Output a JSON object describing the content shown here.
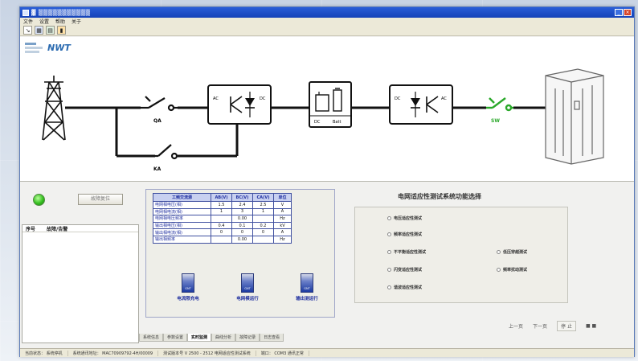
{
  "window": {
    "title": "▓ ▒▒▒▒▒▒▒▒▒▒▒"
  },
  "menu": [
    "文件",
    "设置",
    "帮助",
    "关于"
  ],
  "toolbar_icons": [
    "connect-icon",
    "grid-icon",
    "chart-icon",
    "folder-icon"
  ],
  "brand": {
    "logo_text": "NWT"
  },
  "diagram": {
    "labels": {
      "qa": "QA",
      "ka": "KA",
      "ac1": "AC",
      "dc1": "DC",
      "dc_box": "DC",
      "batt": "Batt",
      "dc2": "DC",
      "ac2": "AC",
      "sw": "SW"
    },
    "colors": {
      "breaker_active": "#29a829",
      "line": "#111111"
    }
  },
  "left_panel": {
    "reset_label": "故障复位",
    "log_headers": [
      "序号",
      "故障/告警"
    ]
  },
  "params": {
    "headers": [
      "工频交流源",
      "AB(V)",
      "BC(V)",
      "CA(V)",
      "单位"
    ],
    "rows": [
      {
        "name": "电网相电压(相)",
        "a": "1.5",
        "b": "2.4",
        "c": "2.5",
        "u": "V"
      },
      {
        "name": "电网相电流(相)",
        "a": "1",
        "b": "3",
        "c": "1",
        "u": "A"
      },
      {
        "name": "电网相电压频率",
        "a": "",
        "b": "0.00",
        "c": "",
        "u": "Hz"
      },
      {
        "name": "输出相电压(相)",
        "a": "0.4",
        "b": "0.1",
        "c": "0.2",
        "u": "kV"
      },
      {
        "name": "输出相电流(相)",
        "a": "0",
        "b": "0",
        "c": "0",
        "u": "A"
      },
      {
        "name": "输出相频率",
        "a": "",
        "b": "0.00",
        "c": "",
        "u": "Hz"
      }
    ],
    "indicators": [
      {
        "label": "电流限充电",
        "chip": "GNT"
      },
      {
        "label": "电网模运行",
        "chip": "GNT"
      },
      {
        "label": "输出测运行",
        "chip": "GNT"
      }
    ]
  },
  "functions": {
    "title": "电网适应性测试系统功能选择",
    "options_left": [
      "电压适应性测试",
      "频率适应性测试",
      "不平衡适应性测试",
      "闪变适应性测试",
      "谐波适应性测试"
    ],
    "options_right": [
      "低压穿越测试",
      "频率扰动测试"
    ]
  },
  "nav": {
    "prev": "上一页",
    "next": "下一页",
    "stop": "停 止",
    "more": "■ ■"
  },
  "tabs": [
    "系统信息",
    "参数设置",
    "实时监测",
    "曲线分析",
    "故障记录",
    "日志查看"
  ],
  "status": [
    "当前状态：  系统停机",
    "系统通讯地址：  MAC70909792-4H/00009",
    "测试版本号 V 2500 - 2512 电网适应性测试系统",
    "端口：  COM3 通讯正常"
  ]
}
